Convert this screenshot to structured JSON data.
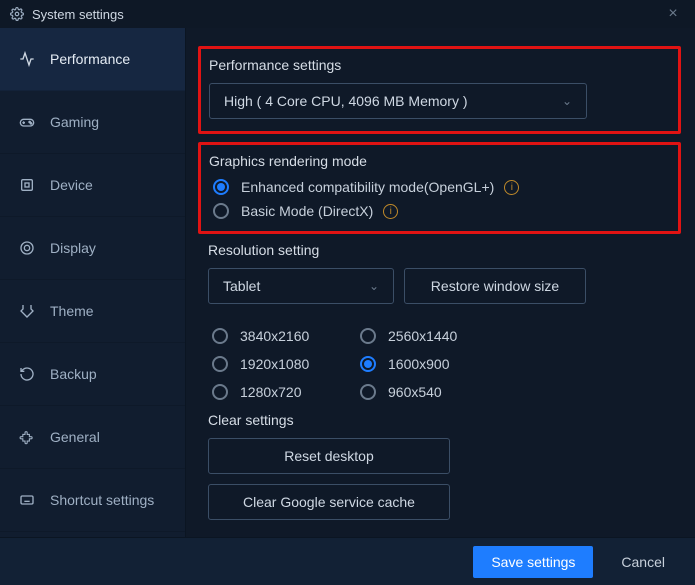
{
  "window": {
    "title": "System settings"
  },
  "sidebar": {
    "items": [
      {
        "label": "Performance"
      },
      {
        "label": "Gaming"
      },
      {
        "label": "Device"
      },
      {
        "label": "Display"
      },
      {
        "label": "Theme"
      },
      {
        "label": "Backup"
      },
      {
        "label": "General"
      },
      {
        "label": "Shortcut settings"
      }
    ]
  },
  "perf": {
    "title": "Performance settings",
    "selected": "High ( 4 Core CPU, 4096 MB Memory )"
  },
  "graphics": {
    "title": "Graphics rendering mode",
    "opt1": "Enhanced compatibility mode(OpenGL+)",
    "opt2": "Basic Mode (DirectX)"
  },
  "resolution": {
    "title": "Resolution setting",
    "selected": "Tablet",
    "restore": "Restore window size",
    "opts": [
      "3840x2160",
      "2560x1440",
      "1920x1080",
      "1600x900",
      "1280x720",
      "960x540"
    ]
  },
  "clear": {
    "title": "Clear settings",
    "reset": "Reset desktop",
    "cache": "Clear Google service cache"
  },
  "footer": {
    "save": "Save settings",
    "cancel": "Cancel"
  }
}
